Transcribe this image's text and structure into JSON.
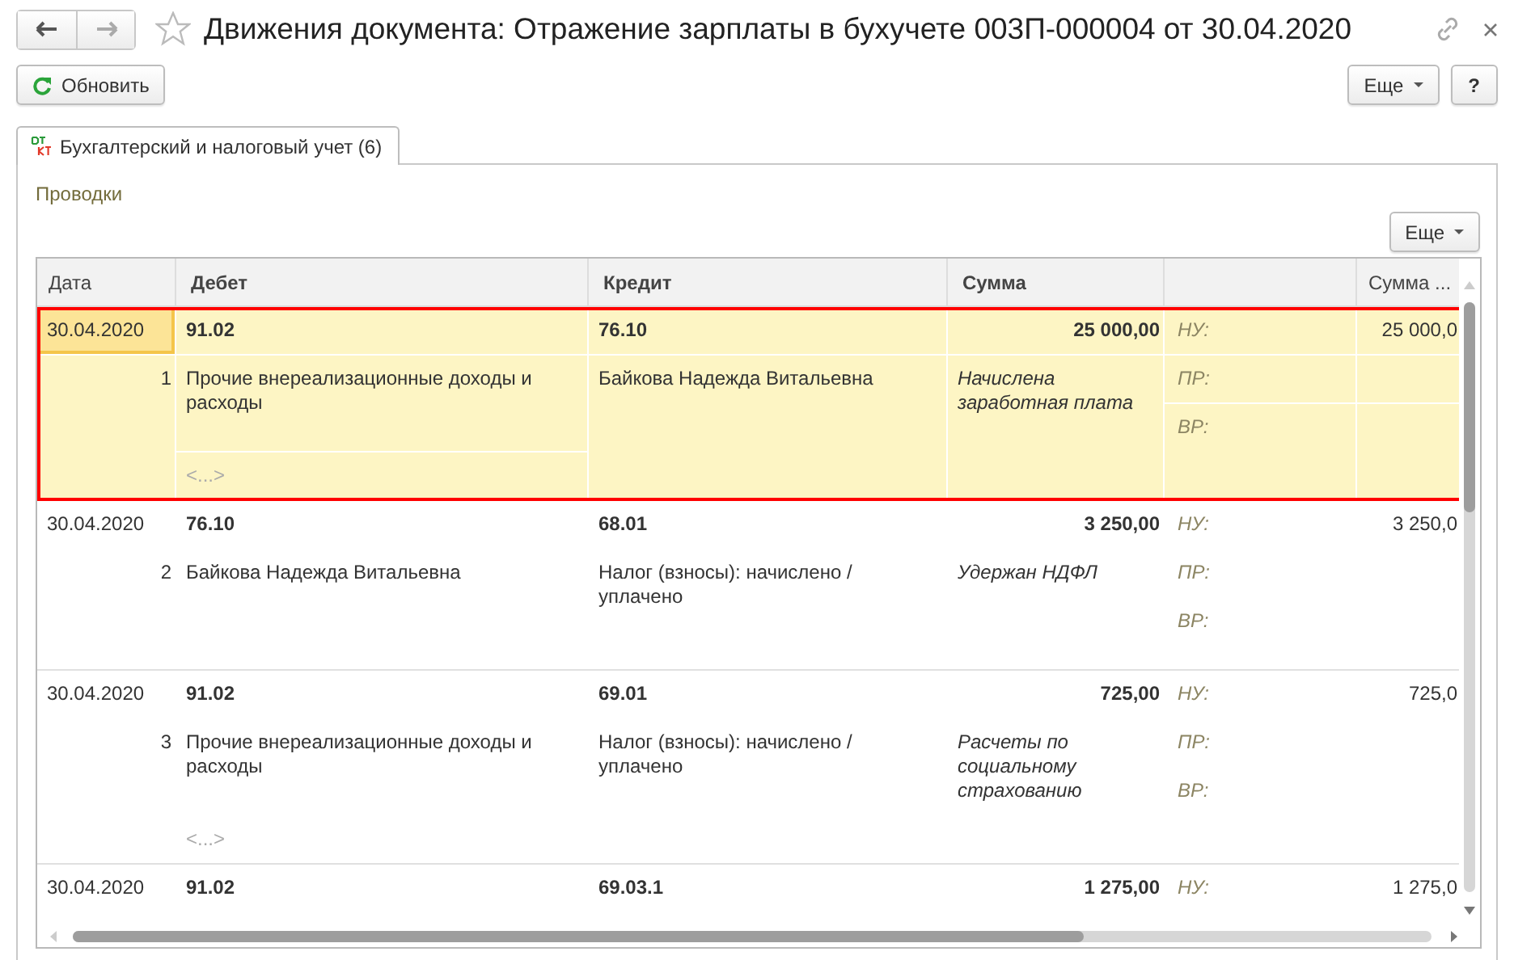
{
  "window": {
    "title": "Движения документа: Отражение зарплаты в бухучете 003П-000004 от 30.04.2020"
  },
  "toolbar": {
    "refresh": "Обновить",
    "more": "Еще",
    "help": "?"
  },
  "tabs": [
    {
      "label": "Бухгалтерский и налоговый учет (6)",
      "selected": true
    }
  ],
  "section_title": "Проводки",
  "table_more": "Еще",
  "table": {
    "columns": [
      {
        "kind": "text",
        "label": "Дата"
      },
      {
        "kind": "bold",
        "label": "Дебет"
      },
      {
        "kind": "bold",
        "label": "Кредит"
      },
      {
        "kind": "bold",
        "label": "Сумма"
      },
      {
        "kind": "blank"
      },
      {
        "kind": "text",
        "label": "Сумма ..."
      }
    ],
    "rows": [
      {
        "selected": true,
        "date": "30.04.2020",
        "number": "1",
        "debit_account": "91.02",
        "debit_subconto": "Прочие внереализационные доходы и расходы",
        "debit_more": "<...>",
        "credit_account": "76.10",
        "credit_subconto": "Байкова Надежда Витальевна",
        "sum": "25 000,00",
        "content": "Начислена заработная плата",
        "tax_labels": [
          "НУ:",
          "ПР:",
          "ВР:"
        ],
        "sum_nu": "25 000,0"
      },
      {
        "selected": false,
        "date": "30.04.2020",
        "number": "2",
        "debit_account": "76.10",
        "debit_subconto": "Байкова Надежда Витальевна",
        "credit_account": "68.01",
        "credit_subconto": "Налог (взносы): начислено / уплачено",
        "sum": "3 250,00",
        "content": "Удержан НДФЛ",
        "tax_labels": [
          "НУ:",
          "ПР:",
          "ВР:"
        ],
        "sum_nu": "3 250,0"
      },
      {
        "selected": false,
        "date": "30.04.2020",
        "number": "3",
        "debit_account": "91.02",
        "debit_subconto": "Прочие внереализационные доходы и расходы",
        "debit_more": "<...>",
        "credit_account": "69.01",
        "credit_subconto": "Налог (взносы): начислено / уплачено",
        "sum": "725,00",
        "content": "Расчеты по социальному страхованию",
        "tax_labels": [
          "НУ:",
          "ПР:",
          "ВР:"
        ],
        "sum_nu": "725,0"
      },
      {
        "selected": false,
        "date": "30.04.2020",
        "debit_account": "91.02",
        "credit_account": "69.03.1",
        "sum": "1 275,00",
        "tax_labels": [
          "НУ:"
        ],
        "sum_nu": "1 275,0"
      }
    ]
  }
}
